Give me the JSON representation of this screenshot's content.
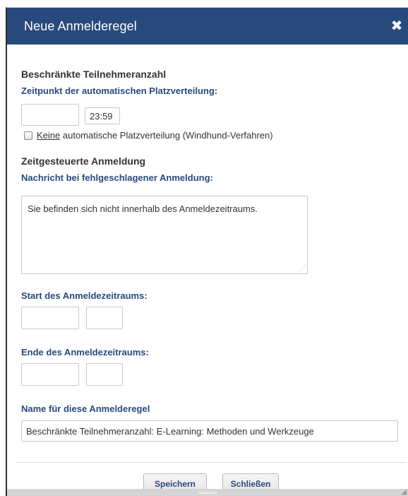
{
  "dialog": {
    "title": "Neue Anmelderegel",
    "close_icon": "✖"
  },
  "participants": {
    "heading": "Beschränkte Teilnehmeranzahl",
    "distribution_label": "Zeitpunkt der automatischen Platzverteilung:",
    "distribution_date": "",
    "distribution_time": "23:59",
    "checkbox_label_underlined": "Keine",
    "checkbox_label_rest": "automatische Platzverteilung (Windhund-Verfahren)",
    "checkbox_checked": false
  },
  "timed": {
    "heading": "Zeitgesteuerte Anmeldung",
    "message_label": "Nachricht bei fehlgeschlagener Anmeldung:",
    "message_value": "Sie befinden sich nicht innerhalb des Anmeldezeitraums.",
    "start_label": "Start des Anmeldezeitraums:",
    "start_date": "",
    "start_time": "",
    "end_label": "Ende des Anmeldezeitraums:",
    "end_date": "",
    "end_time": ""
  },
  "rule_name": {
    "label": "Name für diese Anmelderegel",
    "value": "Beschränkte Teilnehmeranzahl: E-Learning: Methoden und Werkzeuge"
  },
  "buttons": {
    "save": "Speichern",
    "close": "Schließen"
  },
  "colors": {
    "header_bg": "#28497c",
    "label_blue": "#28497c"
  },
  "icons": {
    "close": "close-icon",
    "resize": "resize-grip-icon"
  }
}
